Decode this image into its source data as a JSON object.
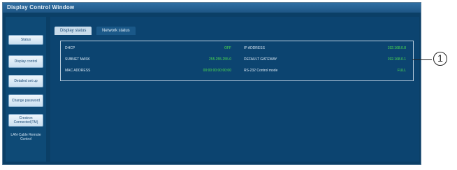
{
  "window": {
    "title": "Display Control Window"
  },
  "sidebar": {
    "buttons": [
      {
        "label": "Status"
      },
      {
        "label": "Display control"
      },
      {
        "label": "Detailed set up"
      },
      {
        "label": "Change password"
      },
      {
        "label": "Crestron Connected(TM)"
      }
    ],
    "link": "LAN-Cable Remote Control"
  },
  "tabs": [
    {
      "label": "Display status",
      "active": true
    },
    {
      "label": "Network status",
      "active": false
    }
  ],
  "status": {
    "left": [
      {
        "label": "DHCP",
        "value": "OFF"
      },
      {
        "label": "SUBNET MASK",
        "value": "255.255.255.0"
      },
      {
        "label": "MAC ADDRESS",
        "value": "00:00:00:00:00:00"
      }
    ],
    "right": [
      {
        "label": "IP ADDRESS",
        "value": "192.168.0.8"
      },
      {
        "label": "DEFAULT GATEWAY",
        "value": "192.168.0.1"
      },
      {
        "label": "RS-232 Control mode",
        "value": "FULL"
      }
    ]
  },
  "callout": "1",
  "colors": {
    "window_bg": "#0b3f66",
    "value_text": "#4ee04e",
    "tab_active": "#c7dbeb"
  }
}
